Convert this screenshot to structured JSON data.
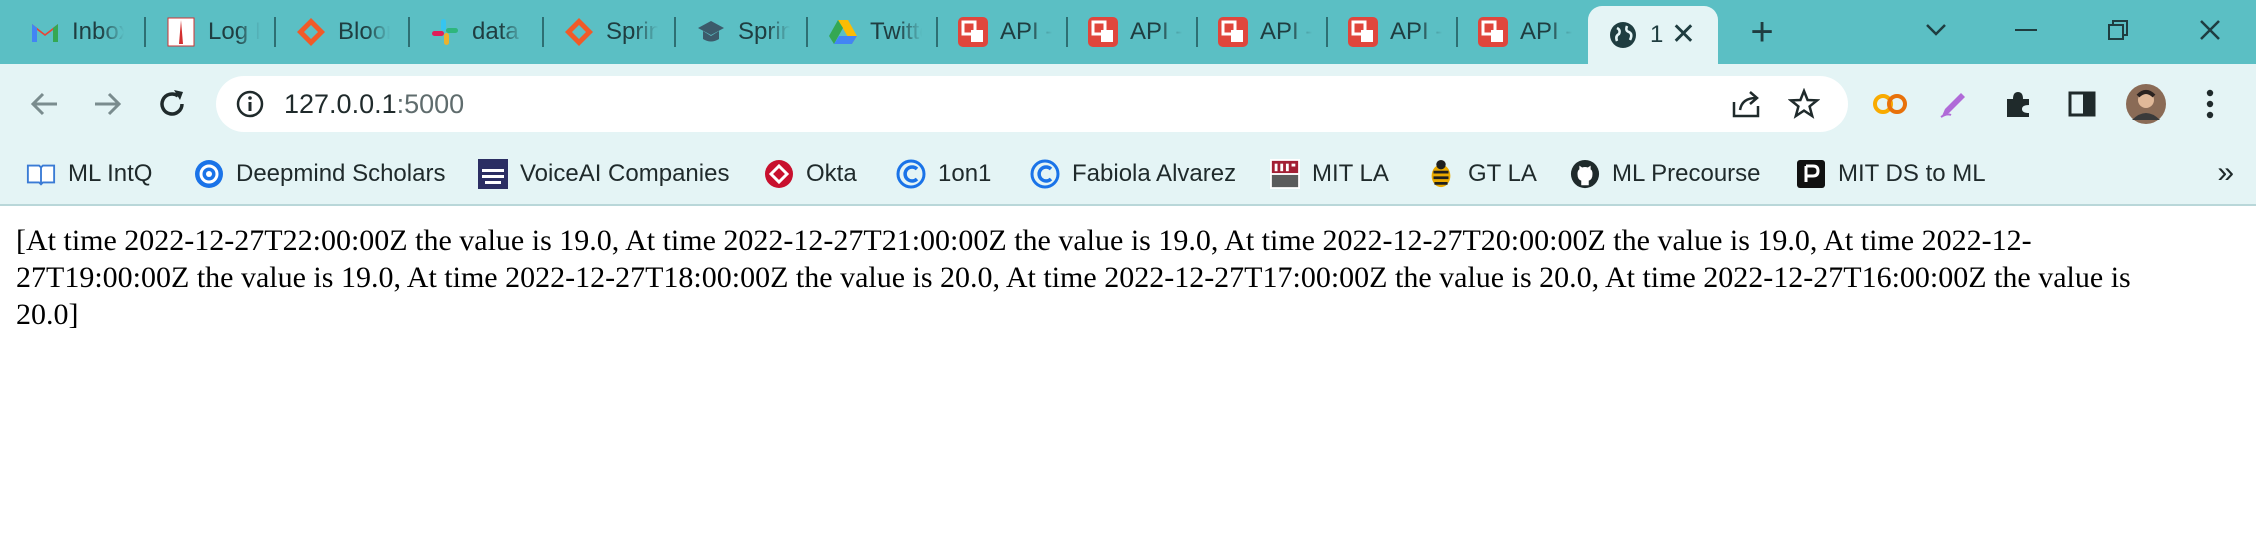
{
  "tabs": [
    {
      "label": "Inbox",
      "icon": "gmail-icon"
    },
    {
      "label": "Log In",
      "icon": "log-icon"
    },
    {
      "label": "Bloomberg",
      "icon": "bloom-icon"
    },
    {
      "label": "data",
      "icon": "slack-icon"
    },
    {
      "label": "Spring",
      "icon": "spring-icon"
    },
    {
      "label": "Spring",
      "icon": "grad-cap-icon"
    },
    {
      "label": "Twitter",
      "icon": "google-drive-icon"
    },
    {
      "label": "API -",
      "icon": "api-icon"
    },
    {
      "label": "API -",
      "icon": "api-icon"
    },
    {
      "label": "API -",
      "icon": "api-icon"
    },
    {
      "label": "API -",
      "icon": "api-icon"
    },
    {
      "label": "API -",
      "icon": "api-icon"
    }
  ],
  "active_tab": {
    "label": "1",
    "icon": "globe-icon"
  },
  "address": {
    "host": "127.0.0.1",
    "port": ":5000"
  },
  "bookmarks": [
    {
      "label": "ML IntQ",
      "icon": "book-icon"
    },
    {
      "label": "Deepmind Scholars",
      "icon": "deepmind-icon"
    },
    {
      "label": "VoiceAI Companies",
      "icon": "voice-icon"
    },
    {
      "label": "Okta",
      "icon": "okta-icon"
    },
    {
      "label": "1on1",
      "icon": "c-icon"
    },
    {
      "label": "Fabiola Alvarez",
      "icon": "c-icon"
    },
    {
      "label": "MIT LA",
      "icon": "mit-icon"
    },
    {
      "label": "GT LA",
      "icon": "gt-icon"
    },
    {
      "label": "ML Precourse",
      "icon": "github-icon"
    },
    {
      "label": "MIT DS to ML",
      "icon": "p-icon"
    }
  ],
  "content": {
    "text": "[At time 2022-12-27T22:00:00Z the value is 19.0, At time 2022-12-27T21:00:00Z the value is 19.0, At time 2022-12-27T20:00:00Z the value is 19.0, At time 2022-12-27T19:00:00Z the value is 19.0, At time 2022-12-27T18:00:00Z the value is 20.0, At time 2022-12-27T17:00:00Z the value is 20.0, At time 2022-12-27T16:00:00Z the value is 20.0]"
  },
  "colors": {
    "tabstrip": "#5bbfc4",
    "toolbar": "#e4f4f5",
    "api_red": "#e0463c"
  }
}
